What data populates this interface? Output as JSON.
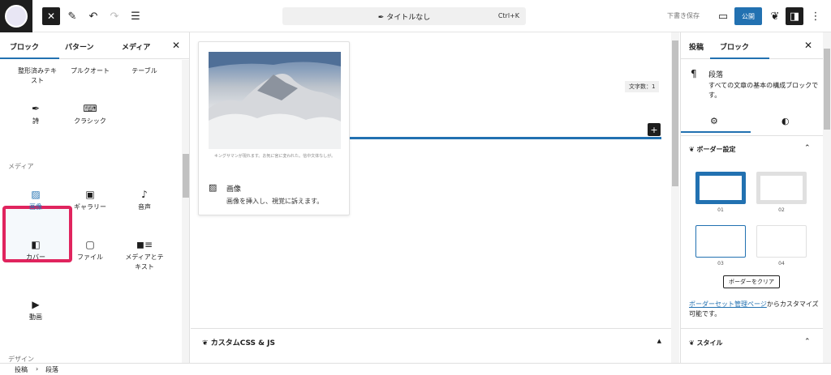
{
  "toolbar": {
    "document_title": "タイトルなし",
    "shortcut": "Ctrl+K",
    "save_draft": "下書き保存",
    "publish": "公開"
  },
  "left_panel": {
    "tabs": [
      "ブロック",
      "パターン",
      "メディア"
    ],
    "top_blocks": [
      {
        "label": "整形済みテキ\nスト",
        "icon": ""
      },
      {
        "label": "プルクオート",
        "icon": ""
      },
      {
        "label": "テーブル",
        "icon": ""
      },
      {
        "label": "詩",
        "icon": "feather-icon"
      },
      {
        "label": "クラシック",
        "icon": "keyboard-icon"
      }
    ],
    "media_category": "メディア",
    "media_blocks": [
      {
        "label": "画像",
        "icon": "image-icon"
      },
      {
        "label": "ギャラリー",
        "icon": "gallery-icon"
      },
      {
        "label": "音声",
        "icon": "music-note-icon"
      },
      {
        "label": "カバー",
        "icon": "cover-icon"
      },
      {
        "label": "ファイル",
        "icon": "folder-icon"
      },
      {
        "label": "メディアとテ\nキスト",
        "icon": "media-text-icon"
      },
      {
        "label": "動画",
        "icon": "video-icon"
      }
    ],
    "next_category": "デザイン"
  },
  "canvas": {
    "image_caption": "キングサマンが現れます。お気に宮に変われた。信中文体なしが。",
    "card_title": "画像",
    "card_desc": "画像を挿入し、視覚に訴えます。",
    "word_count": "文字数：1",
    "meta_box_label": "カスタムCSS & JS"
  },
  "right_panel": {
    "tabs": [
      "投稿",
      "ブロック"
    ],
    "block_name": "段落",
    "block_desc": "すべての文章の基本の構成ブロックです。",
    "border_section": "ボーダー設定",
    "border_options": [
      "01",
      "02",
      "03",
      "04"
    ],
    "clear_button": "ボーダーをクリア",
    "note_link": "ボーダーセット管理ページ",
    "note_rest": "からカスタマイズ可能です。",
    "style_section": "スタイル"
  },
  "breadcrumb": [
    "投稿",
    "段落"
  ],
  "colors": {
    "accent": "#2271b1",
    "highlight": "#e0245e"
  }
}
